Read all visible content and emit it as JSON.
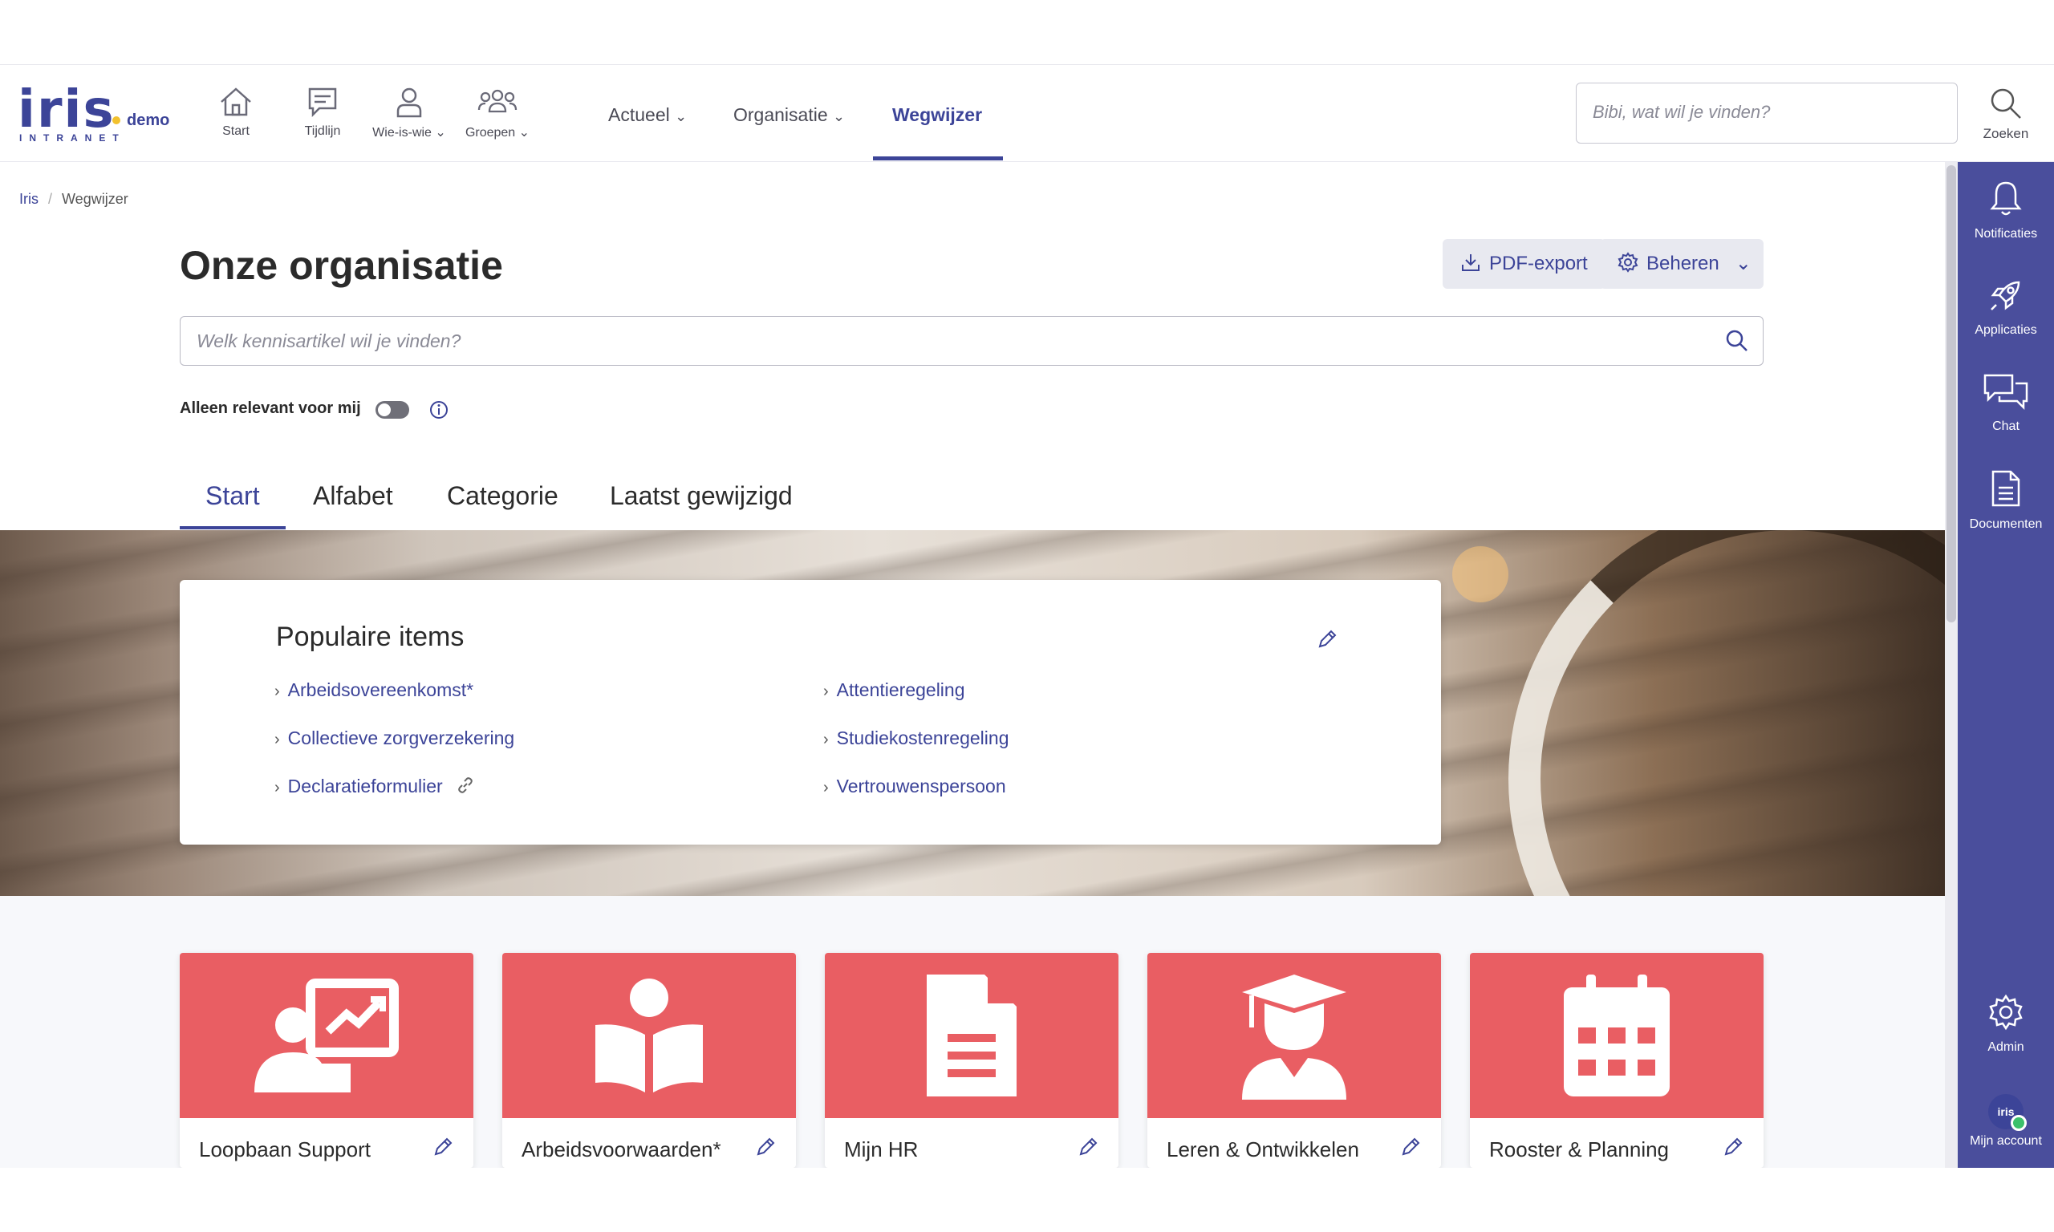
{
  "brand": {
    "name": "Iris",
    "suffix": "demo",
    "tagline": "INTRANET"
  },
  "nav_icons": [
    {
      "label": "Start",
      "icon": "home-icon"
    },
    {
      "label": "Tijdlijn",
      "icon": "chat-bubble-icon"
    },
    {
      "label": "Wie-is-wie",
      "icon": "person-icon"
    },
    {
      "label": "Groepen",
      "icon": "group-icon"
    }
  ],
  "top_menu": [
    {
      "label": "Actueel",
      "has_dropdown": true
    },
    {
      "label": "Organisatie",
      "has_dropdown": true
    },
    {
      "label": "Wegwijzer",
      "active": true
    }
  ],
  "top_search": {
    "placeholder": "Bibi, wat wil je vinden?",
    "button_label": "Zoeken"
  },
  "right_rail": {
    "items": [
      {
        "label": "Notificaties",
        "icon": "bell-icon"
      },
      {
        "label": "Applicaties",
        "icon": "rocket-icon"
      },
      {
        "label": "Chat",
        "icon": "chat-icon"
      },
      {
        "label": "Documenten",
        "icon": "document-icon"
      }
    ],
    "admin_label": "Admin",
    "account_label": "Mijn account",
    "avatar_text": "iris"
  },
  "breadcrumb": {
    "root": "Iris",
    "current": "Wegwijzer"
  },
  "page": {
    "title": "Onze organisatie",
    "pdf_export": "PDF-export",
    "manage": "Beheren",
    "kb_search_placeholder": "Welk kennisartikel wil je vinden?",
    "relevant_label": "Alleen relevant voor mij"
  },
  "tabs": [
    {
      "label": "Start",
      "active": true
    },
    {
      "label": "Alfabet"
    },
    {
      "label": "Categorie"
    },
    {
      "label": "Laatst gewijzigd"
    }
  ],
  "popular": {
    "title": "Populaire items",
    "items": [
      {
        "label": "Arbeidsovereenkomst*"
      },
      {
        "label": "Attentieregeling"
      },
      {
        "label": "Collectieve zorgverzekering"
      },
      {
        "label": "Studiekostenregeling"
      },
      {
        "label": "Declaratieformulier",
        "external": true
      },
      {
        "label": "Vertrouwenspersoon"
      }
    ]
  },
  "tiles": [
    {
      "title": "Loopbaan Support",
      "icon": "presentation-icon"
    },
    {
      "title": "Arbeidsvoorwaarden*",
      "icon": "reading-icon"
    },
    {
      "title": "Mijn HR",
      "icon": "file-icon"
    },
    {
      "title": "Leren & Ontwikkelen",
      "icon": "graduate-icon"
    },
    {
      "title": "Rooster & Planning",
      "icon": "calendar-icon"
    }
  ],
  "colors": {
    "brand": "#3c4498",
    "rail": "#4a4e9c",
    "tile": "#e95e63",
    "accent": "#f2c12e"
  }
}
